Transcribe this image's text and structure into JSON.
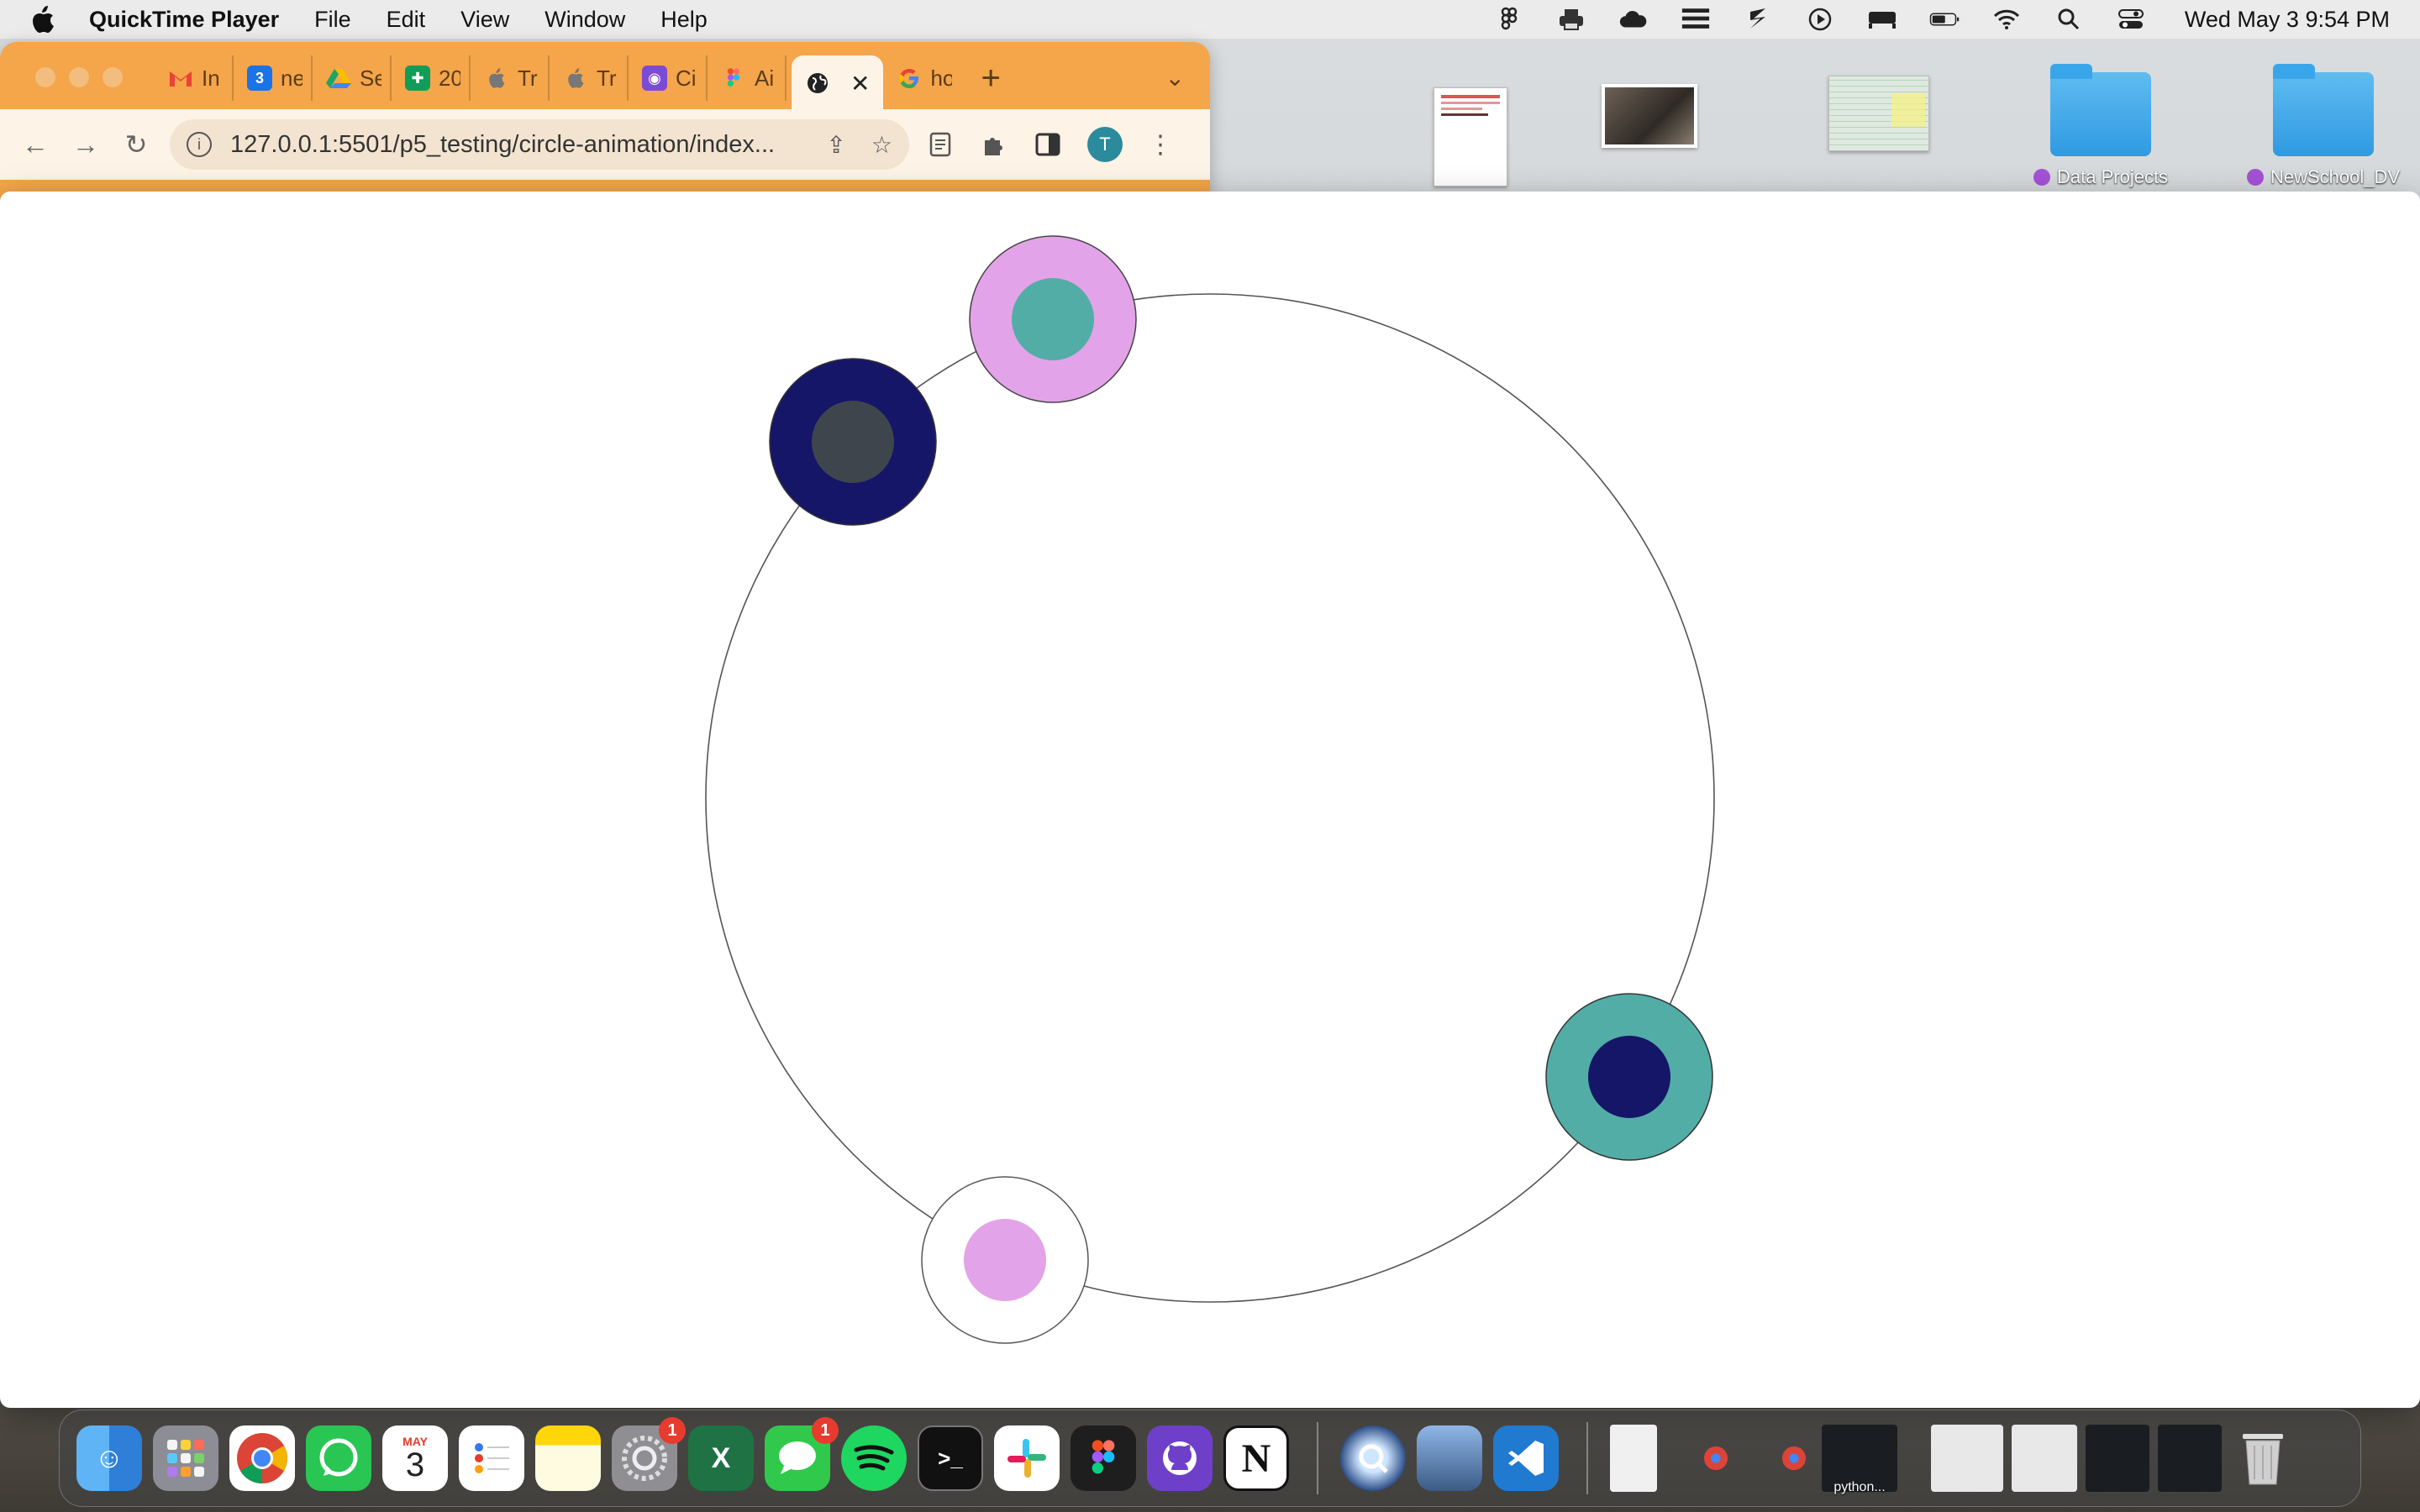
{
  "menubar": {
    "app_name": "QuickTime Player",
    "menus": [
      "File",
      "Edit",
      "View",
      "Window",
      "Help"
    ],
    "clock": "Wed May 3  9:54 PM",
    "status_icons": [
      "figma-icon",
      "printer-icon",
      "cloud-icon",
      "books-icon",
      "zotero-icon",
      "play-icon",
      "bed-icon",
      "battery-icon",
      "wifi-icon",
      "search-icon",
      "control-center-icon"
    ]
  },
  "desktop": {
    "items": [
      {
        "name": "document-thumbnail",
        "label": ""
      },
      {
        "name": "photo-thumbnail",
        "label": ""
      },
      {
        "name": "spreadsheet-thumbnail",
        "label": ""
      },
      {
        "name": "folder-data-projects",
        "label": "Data Projects"
      },
      {
        "name": "folder-newschool-dv",
        "label": "NewSchool_DV"
      }
    ]
  },
  "chrome": {
    "tabs": [
      {
        "name": "gmail-tab",
        "label": "In",
        "color": "#ffffff"
      },
      {
        "name": "calendar-tab",
        "label": "ne",
        "color": "#1a73e8"
      },
      {
        "name": "drive-tab",
        "label": "Se",
        "color": "#1fa463"
      },
      {
        "name": "sheets-tab",
        "label": "20",
        "color": "#0f9d58"
      },
      {
        "name": "apple-tab-1",
        "label": "Tr",
        "color": "#888888"
      },
      {
        "name": "apple-tab-2",
        "label": "Tr",
        "color": "#888888"
      },
      {
        "name": "tab-c",
        "label": "Ci",
        "color": "#7b4bd6"
      },
      {
        "name": "figma-tab",
        "label": "Ai",
        "color": "#f24e1e"
      },
      {
        "name": "active-tab",
        "label": "",
        "color": "#222222"
      },
      {
        "name": "google-tab",
        "label": "ho",
        "color": "#4285f4"
      }
    ],
    "url": "127.0.0.1:5501/p5_testing/circle-animation/index...",
    "avatar_letter": "T"
  },
  "sketch": {
    "orbit_stroke": "#555555",
    "dots": [
      {
        "name": "pink-teal-circle",
        "outer": "#e3a3e8",
        "inner": "#52ada6"
      },
      {
        "name": "navy-gray-circle",
        "outer": "#151668",
        "inner": "#3f454c"
      },
      {
        "name": "teal-navy-circle",
        "outer": "#52ada6",
        "inner": "#151668"
      },
      {
        "name": "white-pink-circle",
        "outer": "#ffffff",
        "inner": "#e3a3e8"
      }
    ]
  },
  "dock": {
    "calendar_month": "MAY",
    "calendar_day": "3",
    "badges": {
      "system_settings": "1",
      "messages": "1"
    },
    "python_label": "python..."
  }
}
